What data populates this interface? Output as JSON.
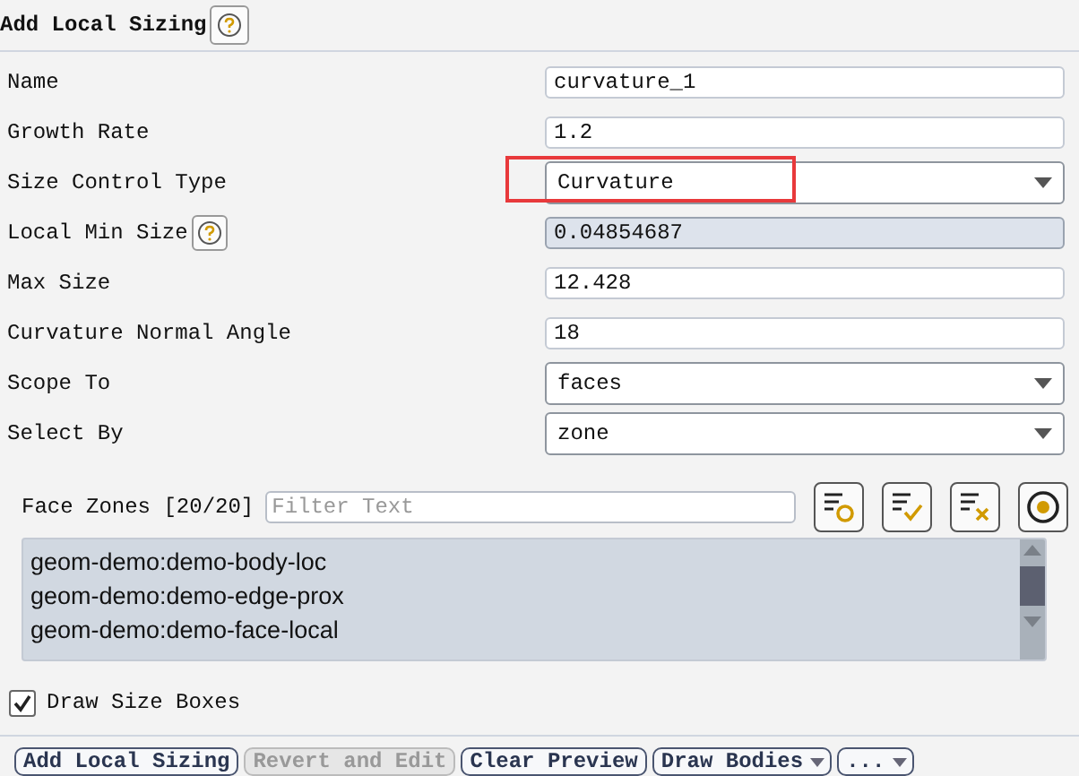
{
  "panel": {
    "title": "Add Local Sizing",
    "help": true
  },
  "fields": [
    {
      "label": "Name",
      "kind": "text",
      "value": "curvature_1",
      "help": false,
      "highlighted": false
    },
    {
      "label": "Growth Rate",
      "kind": "text",
      "value": "1.2",
      "help": false,
      "highlighted": false
    },
    {
      "label": "Size Control Type",
      "kind": "select",
      "value": "Curvature",
      "help": false,
      "highlighted": true
    },
    {
      "label": "Local Min Size",
      "kind": "readonly",
      "value": "0.04854687",
      "help": true,
      "highlighted": false
    },
    {
      "label": "Max Size",
      "kind": "text",
      "value": "12.428",
      "help": false,
      "highlighted": false
    },
    {
      "label": "Curvature Normal Angle",
      "kind": "text",
      "value": "18",
      "help": false,
      "highlighted": false
    },
    {
      "label": "Scope To",
      "kind": "select",
      "value": "faces",
      "help": false,
      "highlighted": false
    },
    {
      "label": "Select By",
      "kind": "select",
      "value": "zone",
      "help": false,
      "highlighted": false
    }
  ],
  "zones": {
    "label": "Face Zones [20/20]",
    "placeholder": "Filter Text",
    "items": [
      "geom-demo:demo-body-loc",
      "geom-demo:demo-edge-prox",
      "geom-demo:demo-face-local"
    ]
  },
  "draw_size_boxes": {
    "label": "Draw Size Boxes",
    "checked": true
  },
  "buttons": [
    {
      "label": "Add Local Sizing",
      "kind": "button"
    },
    {
      "label": "Revert and Edit",
      "kind": "disabled"
    },
    {
      "label": "Clear Preview",
      "kind": "button"
    },
    {
      "label": "Draw Bodies",
      "kind": "dropdown"
    },
    {
      "label": "...",
      "kind": "dropdown"
    }
  ]
}
